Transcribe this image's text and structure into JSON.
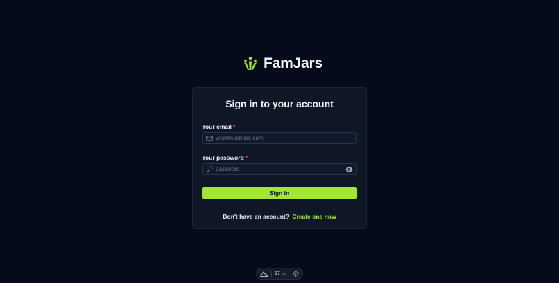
{
  "brand": {
    "name": "FamJars",
    "accent": "#a3e635"
  },
  "signin": {
    "title": "Sign in to your account",
    "email": {
      "label": "Your email",
      "required_mark": "*",
      "placeholder": "you@example.com",
      "value": "",
      "icon": "mail-icon"
    },
    "password": {
      "label": "Your password",
      "required_mark": "*",
      "placeholder": "password",
      "value": "",
      "icon": "key-icon",
      "toggle_icon": "eye-icon"
    },
    "submit_label": "Sign in",
    "signup_prompt": "Don't have an account?",
    "signup_link": "Create one now"
  },
  "devtools": {
    "render_time": "17",
    "render_time_unit": "ms",
    "icons": [
      "nuxt-icon",
      "target-icon"
    ]
  },
  "colors": {
    "background": "#050b1a",
    "card": "#0f1727",
    "button": "#a3e635",
    "required": "#ef4b4b"
  }
}
